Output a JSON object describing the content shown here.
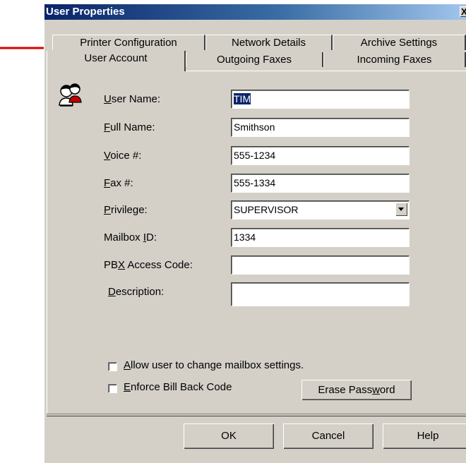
{
  "window": {
    "title": "User Properties",
    "close_label": "X"
  },
  "tabs": {
    "row1": [
      {
        "label": "Printer Configuration"
      },
      {
        "label": "Network Details"
      },
      {
        "label": "Archive Settings"
      }
    ],
    "row2": [
      {
        "label": "User Account",
        "active": true
      },
      {
        "label": "Outgoing Faxes"
      },
      {
        "label": "Incoming Faxes"
      }
    ]
  },
  "form": {
    "user_name": {
      "label_prefix": "",
      "label_mnemonic": "U",
      "label_rest": "ser Name:",
      "value": "TIM"
    },
    "full_name": {
      "label_prefix": "",
      "label_mnemonic": "F",
      "label_rest": "ull Name:",
      "value": "Smithson"
    },
    "voice": {
      "label_prefix": "",
      "label_mnemonic": "V",
      "label_rest": "oice #:",
      "value": "555-1234"
    },
    "fax": {
      "label_prefix": "",
      "label_mnemonic": "F",
      "label_rest": "ax #:",
      "value": "555-1334"
    },
    "privilege": {
      "label_prefix": "",
      "label_mnemonic": "P",
      "label_rest": "rivilege:",
      "value": "SUPERVISOR"
    },
    "mailbox_id": {
      "label_prefix": "Mailbox ",
      "label_mnemonic": "I",
      "label_rest": "D:",
      "value": "1334"
    },
    "pbx_access_code": {
      "label_prefix": "PB",
      "label_mnemonic": "X",
      "label_rest": " Access Code:",
      "value": ""
    },
    "description": {
      "label_prefix": "",
      "label_mnemonic": "D",
      "label_rest": "escription:",
      "value": ""
    }
  },
  "options": {
    "allow_change": {
      "label_mnemonic": "A",
      "label_rest": "llow user to change mailbox settings.",
      "checked": false
    },
    "enforce_bill_back": {
      "label_mnemonic": "E",
      "label_rest": "nforce Bill Back Code",
      "checked": false
    }
  },
  "buttons": {
    "erase_password": {
      "prefix": "Erase Pass",
      "mnemonic": "w",
      "rest": "ord"
    },
    "ok": "OK",
    "cancel": "Cancel",
    "help": "Help"
  },
  "colors": {
    "dialog_face": "#d4d0c8",
    "title_bar": "#0a246a",
    "annotation_arrow": "#e00000"
  },
  "icons": {
    "annotation": "arrow-right-icon",
    "user": "users-icon",
    "dropdown": "chevron-down-icon"
  }
}
